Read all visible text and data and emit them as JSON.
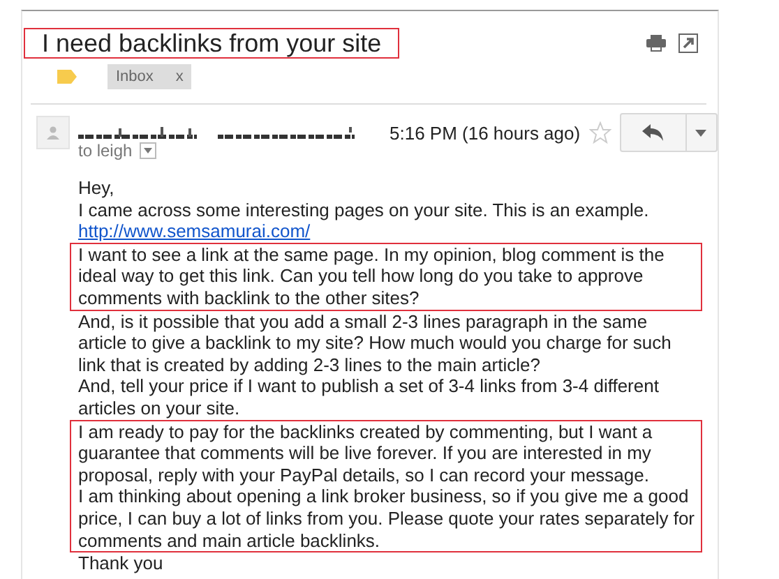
{
  "subject": "I need backlinks from your site",
  "labels": [
    {
      "text": "Inbox",
      "remove": "x"
    }
  ],
  "message": {
    "time": "5:16 PM (16 hours ago)",
    "starred": false,
    "recipient": "to leigh",
    "body": [
      {
        "kind": "text",
        "text": "Hey,"
      },
      {
        "kind": "text",
        "text": "I came across some interesting pages on your site. This is an example."
      },
      {
        "kind": "link",
        "text": "http://www.semsamurai.com/"
      },
      {
        "kind": "boxed",
        "paragraphs": [
          "I want to see a link at the same page. In my opinion, blog comment is the ideal way to get this link. Can you tell how long do you take to approve comments with backlink to the other sites?"
        ]
      },
      {
        "kind": "text",
        "text": "And, is it possible that you add a small 2-3 lines paragraph in the same article to give a backlink to my site?  How much would you charge for such link that is created by adding 2-3 lines to the main article?"
      },
      {
        "kind": "text",
        "text": "And, tell your price if I want to publish a set of 3-4 links from 3-4 different articles on your site."
      },
      {
        "kind": "boxed",
        "paragraphs": [
          "I am ready to pay for the backlinks created by commenting, but I want a guarantee that comments will be live forever. If you are interested in my proposal, reply with your PayPal details, so I can record your message.",
          "I am thinking about opening a link broker business, so if you give me a good price, I can buy a lot of links from you. Please quote your rates separately for comments and main article backlinks."
        ]
      },
      {
        "kind": "text",
        "text": "Thank you"
      }
    ]
  }
}
